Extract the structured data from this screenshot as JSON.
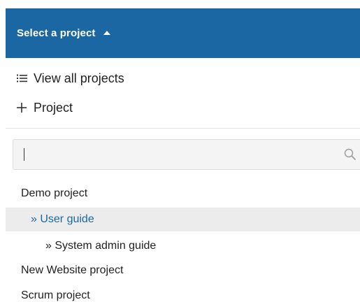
{
  "header": {
    "label": "Select a project",
    "caret_icon": "caret-up-icon",
    "background_color": "#1a67a3"
  },
  "menu": {
    "view_all": {
      "label": "View all projects",
      "icon": "list-icon"
    },
    "new_project": {
      "label": "Project",
      "icon": "plus-icon"
    }
  },
  "search": {
    "value": "",
    "placeholder": "",
    "icon": "search-icon"
  },
  "projects": [
    {
      "label": "Demo project",
      "level": 0,
      "selected": false
    },
    {
      "label": "» User guide",
      "level": 1,
      "selected": true
    },
    {
      "label": "» System admin guide",
      "level": 2,
      "selected": false
    },
    {
      "label": "New Website project",
      "level": 0,
      "selected": false
    },
    {
      "label": "Scrum project",
      "level": 0,
      "selected": false
    }
  ],
  "colors": {
    "accent": "#1a67a3",
    "selected_row_background": "#ececec"
  }
}
